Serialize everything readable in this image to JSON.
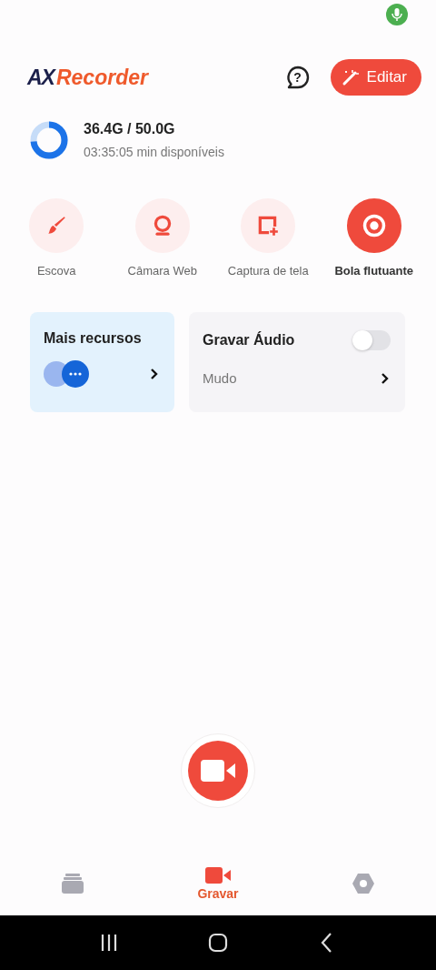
{
  "logo": {
    "mark": "AX",
    "name": "Recorder"
  },
  "help_button": {
    "label": "?"
  },
  "edit_button": {
    "label": "Editar"
  },
  "storage": {
    "usage": "36.4G / 50.0G",
    "remaining": "03:35:05 min disponíveis",
    "level": 0.73
  },
  "tools": [
    {
      "kind": "brush",
      "label": "Escova",
      "selected": false
    },
    {
      "kind": "webcam",
      "label": "Câmara Web",
      "selected": false
    },
    {
      "kind": "screenshot",
      "label": "Captura de tela",
      "selected": false
    },
    {
      "kind": "ball",
      "label": "Bola flutuante",
      "selected": true
    }
  ],
  "more_card": {
    "title": "Mais recursos"
  },
  "audio_card": {
    "title": "Gravar Áudio",
    "on": false,
    "mode": "Mudo"
  },
  "bottom_tabs": [
    {
      "kind": "files",
      "selected": false
    },
    {
      "kind": "record",
      "label": "Gravar",
      "selected": true
    },
    {
      "kind": "settings",
      "selected": false
    }
  ]
}
